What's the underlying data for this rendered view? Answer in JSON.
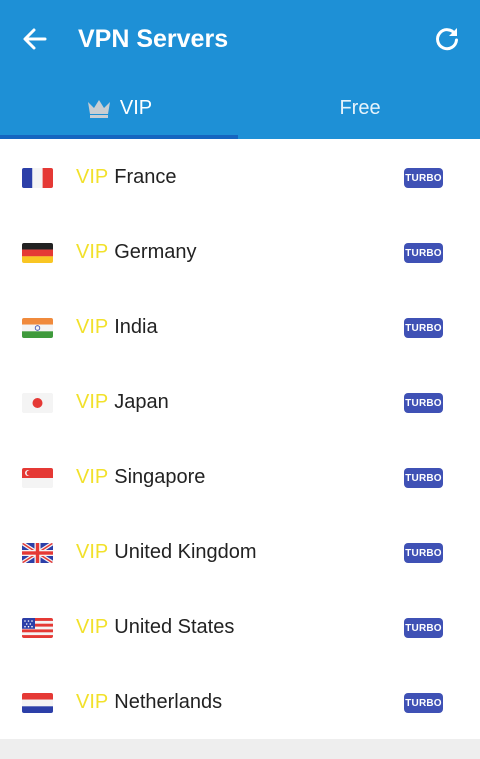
{
  "header": {
    "title": "VPN Servers"
  },
  "tabs": [
    {
      "label": "VIP",
      "selected": true
    },
    {
      "label": "Free",
      "selected": false
    }
  ],
  "servers": [
    {
      "prefix": "VIP",
      "country": "France",
      "badge": "TURBO",
      "flag_icon": "flag-france-icon"
    },
    {
      "prefix": "VIP",
      "country": "Germany",
      "badge": "TURBO",
      "flag_icon": "flag-germany-icon"
    },
    {
      "prefix": "VIP",
      "country": "India",
      "badge": "TURBO",
      "flag_icon": "flag-india-icon"
    },
    {
      "prefix": "VIP",
      "country": "Japan",
      "badge": "TURBO",
      "flag_icon": "flag-japan-icon"
    },
    {
      "prefix": "VIP",
      "country": "Singapore",
      "badge": "TURBO",
      "flag_icon": "flag-singapore-icon"
    },
    {
      "prefix": "VIP",
      "country": "United Kingdom",
      "badge": "TURBO",
      "flag_icon": "flag-uk-icon"
    },
    {
      "prefix": "VIP",
      "country": "United States",
      "badge": "TURBO",
      "flag_icon": "flag-us-icon"
    },
    {
      "prefix": "VIP",
      "country": "Netherlands",
      "badge": "TURBO",
      "flag_icon": "flag-netherlands-icon"
    }
  ],
  "colors": {
    "appbar": "#1e90d6",
    "indicator": "#1565c0",
    "vip_text": "#f2e12b",
    "badge": "#3f51b5"
  }
}
